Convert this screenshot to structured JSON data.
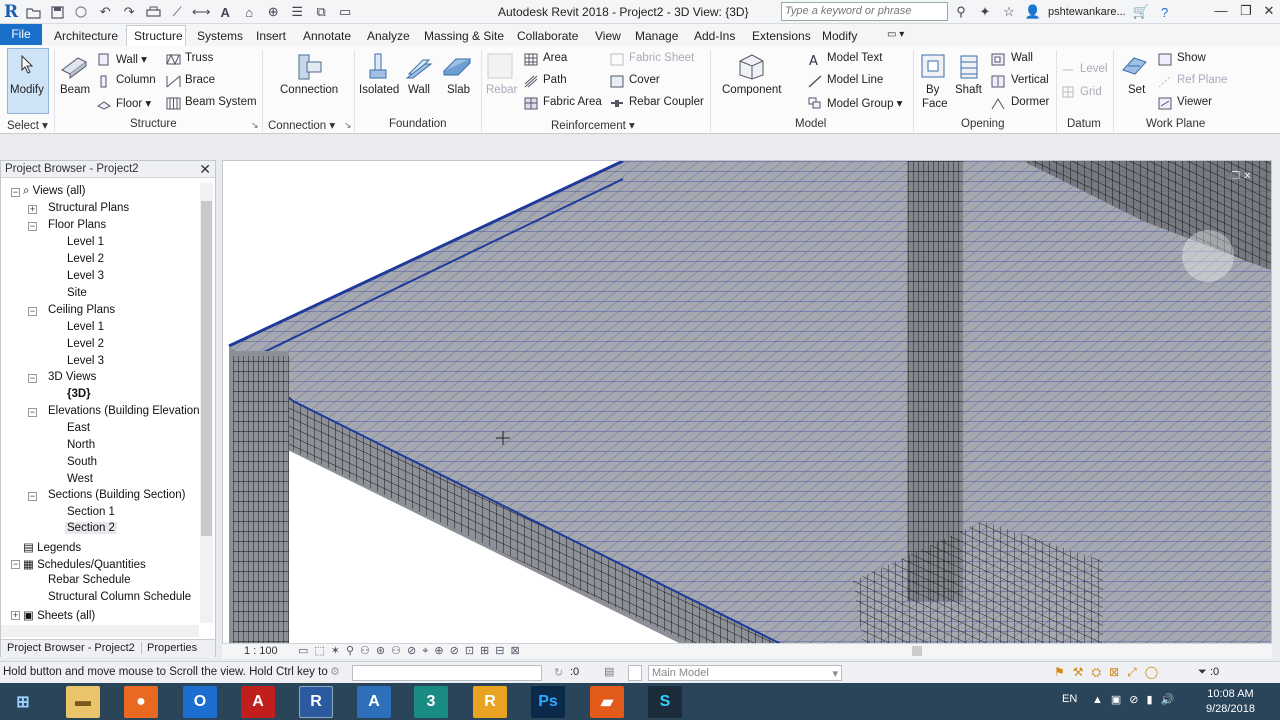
{
  "window": {
    "app_title": "Autodesk Revit 2018 -   Project2 - 3D View: {3D}",
    "search_placeholder": "Type a keyword or phrase",
    "user_name": "pshtewankare...",
    "logo": "R"
  },
  "tabs": [
    "File",
    "Architecture",
    "Structure",
    "Systems",
    "Insert",
    "Annotate",
    "Analyze",
    "Massing & Site",
    "Collaborate",
    "View",
    "Manage",
    "Add-Ins",
    "Extensions",
    "Modify"
  ],
  "active_tab": "Structure",
  "ribbon": {
    "select": {
      "modify": "Modify",
      "panel": "Select"
    },
    "structure": {
      "beam": "Beam",
      "wall": "Wall",
      "column": "Column",
      "floor": "Floor",
      "truss": "Truss",
      "brace": "Brace",
      "beam_system": "Beam  System",
      "panel": "Structure"
    },
    "connection": {
      "connection": "Connection",
      "panel": "Connection"
    },
    "foundation": {
      "isolated": "Isolated",
      "wall": "Wall",
      "slab": "Slab",
      "panel": "Foundation"
    },
    "reinforcement": {
      "rebar": "Rebar",
      "area": "Area",
      "path": "Path",
      "fabric_area": "Fabric  Area",
      "fabric_sheet": "Fabric  Sheet",
      "cover": "Cover",
      "rebar_coupler": "Rebar  Coupler",
      "panel": "Reinforcement"
    },
    "model": {
      "component": "Component",
      "model_text": "Model  Text",
      "model_line": "Model  Line",
      "model_group": "Model  Group",
      "panel": "Model"
    },
    "opening": {
      "by_face_1": "By",
      "by_face_2": "Face",
      "shaft": "Shaft",
      "wall": "Wall",
      "vertical": "Vertical",
      "dormer": "Dormer",
      "panel": "Opening"
    },
    "datum": {
      "level": "Level",
      "grid": "Grid",
      "panel": "Datum"
    },
    "work_plane": {
      "set": "Set",
      "show": "Show",
      "ref_plane": "Ref  Plane",
      "viewer": "Viewer",
      "panel": "Work Plane"
    }
  },
  "project_browser": {
    "title": "Project Browser - Project2",
    "items": [
      {
        "label": "Views (all)"
      },
      {
        "label": "Structural Plans"
      },
      {
        "label": "Floor Plans"
      },
      {
        "label": "Level 1"
      },
      {
        "label": "Level 2"
      },
      {
        "label": "Level 3"
      },
      {
        "label": "Site"
      },
      {
        "label": "Ceiling Plans"
      },
      {
        "label": "Level 1"
      },
      {
        "label": "Level 2"
      },
      {
        "label": "Level 3"
      },
      {
        "label": "3D Views"
      },
      {
        "label": "{3D}"
      },
      {
        "label": "Elevations (Building Elevation"
      },
      {
        "label": "East"
      },
      {
        "label": "North"
      },
      {
        "label": "South"
      },
      {
        "label": "West"
      },
      {
        "label": "Sections (Building Section)"
      },
      {
        "label": "Section 1"
      },
      {
        "label": "Section 2"
      },
      {
        "label": "Legends"
      },
      {
        "label": "Schedules/Quantities"
      },
      {
        "label": "Rebar Schedule"
      },
      {
        "label": "Structural Column Schedule"
      },
      {
        "label": "Sheets (all)"
      }
    ],
    "bottom_tabs": [
      "Project Browser - Project2",
      "Properties"
    ]
  },
  "view_bar": {
    "scale": "1 : 100"
  },
  "status": {
    "hint": "Hold button and move mouse to Scroll the view. Hold Ctrl key to",
    "zero": ":0",
    "model": "Main Model",
    "filter": ":0"
  },
  "taskbar": {
    "apps": [
      "Start",
      "Explorer",
      "Firefox",
      "Outlook",
      "AutoCAD",
      "Revit",
      "AutoCAD Architecture",
      "3ds Max",
      "Revit Alt",
      "Photoshop",
      "Office",
      "Other"
    ],
    "lang": "EN",
    "time": "10:08 AM",
    "date": "9/28/2018"
  },
  "colors": {
    "accent": "#1a6fc9",
    "rebar_blue": "#2a3f9e",
    "taskbar": "#2a4459"
  }
}
